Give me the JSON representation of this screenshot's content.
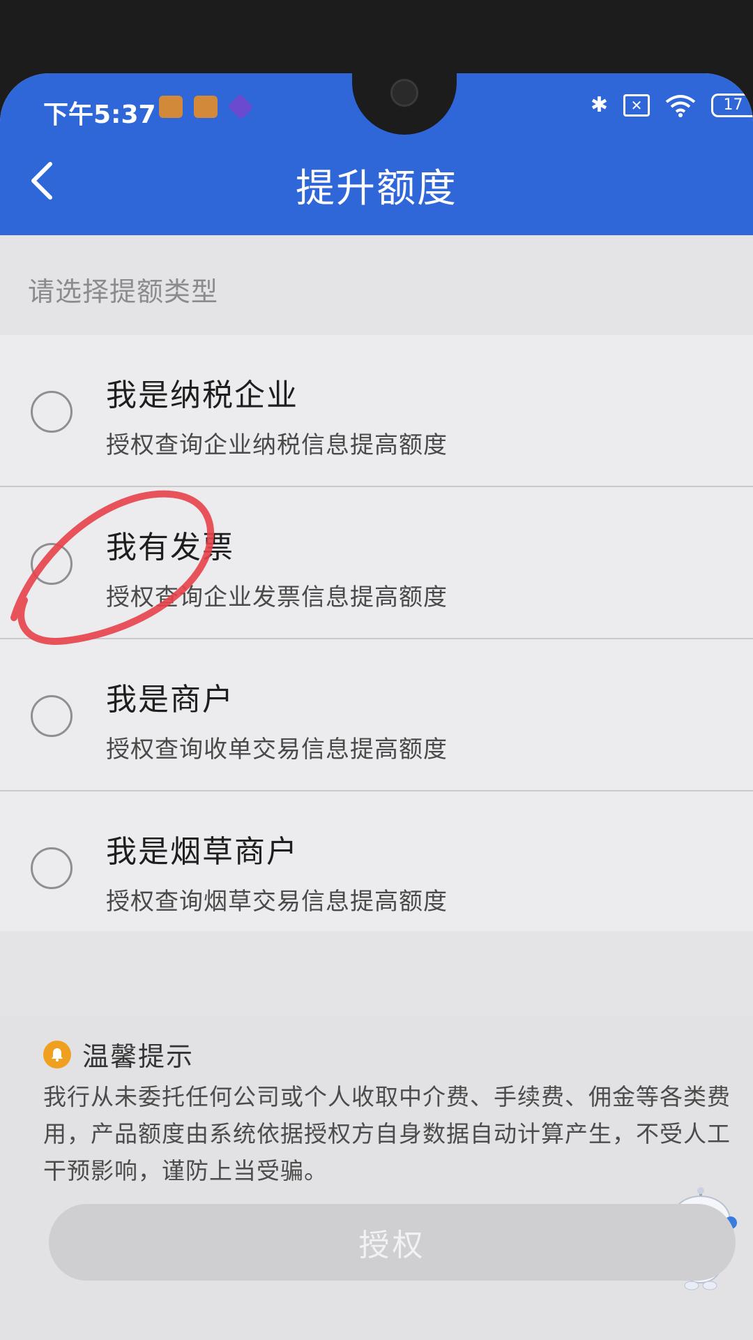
{
  "status_bar": {
    "time": "下午5:37",
    "battery": "17",
    "icons": [
      "app-notification-icon",
      "app-notification-icon",
      "app-notification-icon",
      "bluetooth-icon",
      "sim-icon",
      "wifi-icon",
      "battery-icon"
    ]
  },
  "header": {
    "title": "提升额度",
    "back_icon": "chevron-left-icon"
  },
  "section_label": "请选择提额类型",
  "options": [
    {
      "title": "我是纳税企业",
      "desc": "授权查询企业纳税信息提高额度",
      "selected": false
    },
    {
      "title": "我有发票",
      "desc": "授权查询企业发票信息提高额度",
      "selected": false
    },
    {
      "title": "我是商户",
      "desc": "授权查询收单交易信息提高额度",
      "selected": false
    },
    {
      "title": "我是烟草商户",
      "desc": "授权查询烟草交易信息提高额度",
      "selected": false
    }
  ],
  "tips": {
    "title": "温馨提示",
    "body": "我行从未委托任何公司或个人收取中介费、手续费、佣金等各类费用，产品额度由系统依据授权方自身数据自动计算产生，不受人工干预影响，谨防上当受骗。"
  },
  "auth_button": "授权",
  "colors": {
    "header_blue": "#2f66d8",
    "annotation_red": "#e8424a",
    "bell_orange": "#f0a020"
  }
}
